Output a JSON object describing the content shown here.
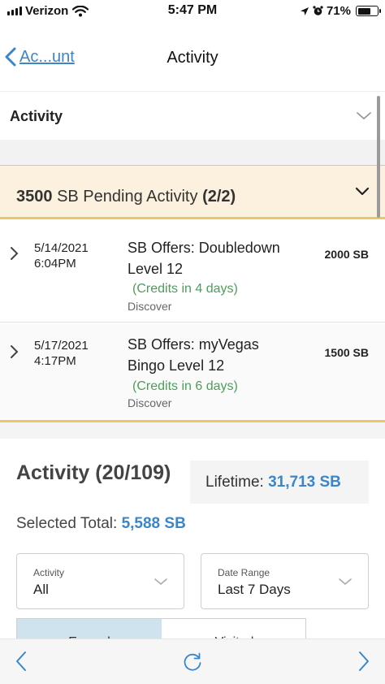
{
  "status_bar": {
    "carrier": "Verizon",
    "time": "5:47 PM",
    "battery": "71%",
    "battery_level": 0.71
  },
  "nav": {
    "back_label": "Ac...unt",
    "title": "Activity"
  },
  "activity_filter_header": {
    "label": "Activity"
  },
  "pending": {
    "amount_label": "3500",
    "middle_label": "SB Pending Activity",
    "count_label": "(2/2)"
  },
  "pending_items": [
    {
      "date": "5/14/2021",
      "time": "6:04PM",
      "description": "SB Offers: Doubledown Level 12",
      "credits": "(Credits in 4 days)",
      "source": "Discover",
      "amount": "2000 SB"
    },
    {
      "date": "5/17/2021",
      "time": "4:17PM",
      "description": "SB Offers: myVegas Bingo Level 12",
      "credits": "(Credits in 6 days)",
      "source": "Discover",
      "amount": "1500 SB"
    }
  ],
  "summary": {
    "title": "Activity (20/109)",
    "lifetime_label": "Lifetime:",
    "lifetime_value": "31,713 SB",
    "selected_label": "Selected Total:",
    "selected_value": "5,588 SB"
  },
  "filters": {
    "activity": {
      "label": "Activity",
      "value": "All"
    },
    "date_range": {
      "label": "Date Range",
      "value": "Last 7 Days"
    }
  },
  "tabs": [
    {
      "label": "Earned"
    },
    {
      "label": "Visited"
    }
  ],
  "colors": {
    "link_blue": "#3a86c8",
    "pending_bg": "#fbf1de",
    "pending_border": "#e8c860",
    "credit_green": "#4e9d5a"
  }
}
